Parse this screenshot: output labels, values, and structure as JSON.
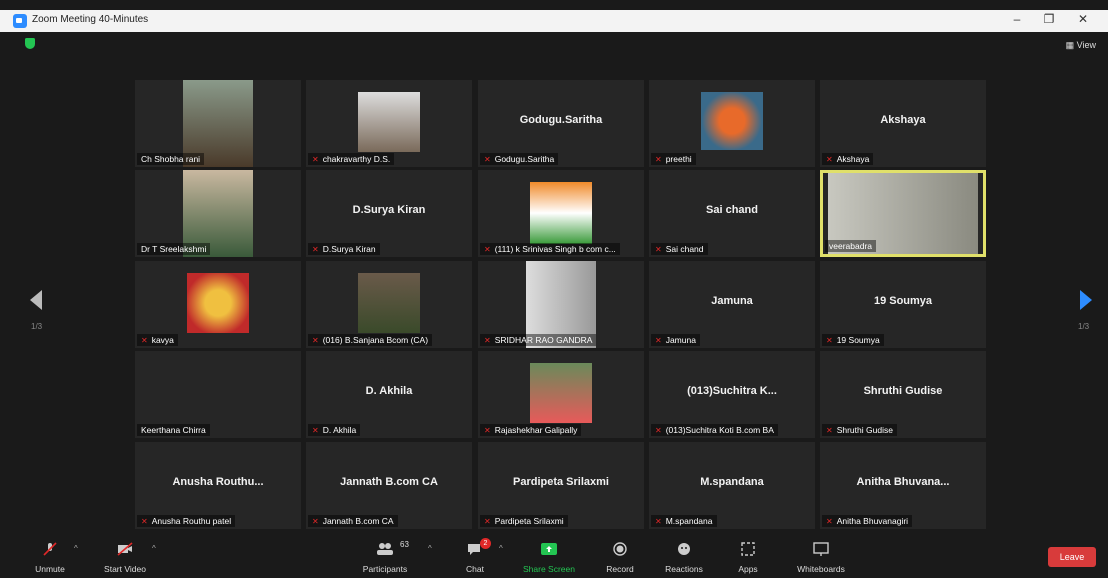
{
  "window": {
    "title": "Zoom Meeting 40-Minutes",
    "view_label": "View"
  },
  "paging": {
    "left": "1/3",
    "right": "1/3"
  },
  "tiles": [
    {
      "name": "Ch Shobha rani",
      "display": "",
      "muted": false
    },
    {
      "name": "chakravarthy D.S.",
      "display": "",
      "muted": true
    },
    {
      "name": "Godugu.Saritha",
      "display": "Godugu.Saritha",
      "muted": true
    },
    {
      "name": "preethi",
      "display": "",
      "muted": true
    },
    {
      "name": "Akshaya",
      "display": "Akshaya",
      "muted": true
    },
    {
      "name": "Dr T Sreelakshmi",
      "display": "",
      "muted": false
    },
    {
      "name": "D.Surya Kiran",
      "display": "D.Surya Kiran",
      "muted": true
    },
    {
      "name": "(111) k Srinivas Singh b com c...",
      "display": "",
      "muted": true
    },
    {
      "name": "Sai chand",
      "display": "Sai chand",
      "muted": true
    },
    {
      "name": "veerabadra",
      "display": "",
      "muted": false
    },
    {
      "name": "kavya",
      "display": "",
      "muted": true
    },
    {
      "name": "(016) B.Sanjana Bcom (CA)",
      "display": "",
      "muted": true
    },
    {
      "name": "SRIDHAR RAO GANDRA",
      "display": "",
      "muted": true
    },
    {
      "name": "Jamuna",
      "display": "Jamuna",
      "muted": true
    },
    {
      "name": "19 Soumya",
      "display": "19 Soumya",
      "muted": true
    },
    {
      "name": "Keerthana Chirra",
      "display": "",
      "muted": false
    },
    {
      "name": "D. Akhila",
      "display": "D. Akhila",
      "muted": true
    },
    {
      "name": "Rajashekhar Galipally",
      "display": "",
      "muted": true
    },
    {
      "name": "(013)Suchitra Koti B.com BA",
      "display": "(013)Suchitra K...",
      "muted": true
    },
    {
      "name": "Shruthi Gudise",
      "display": "Shruthi Gudise",
      "muted": true
    },
    {
      "name": "Anusha Routhu patel",
      "display": "Anusha Routhu...",
      "muted": true
    },
    {
      "name": "Jannath B.com CA",
      "display": "Jannath B.com CA",
      "muted": true
    },
    {
      "name": "Pardipeta Srilaxmi",
      "display": "Pardipeta Srilaxmi",
      "muted": true
    },
    {
      "name": "M.spandana",
      "display": "M.spandana",
      "muted": true
    },
    {
      "name": "Anitha Bhuvanagiri",
      "display": "Anitha Bhuvana...",
      "muted": true
    }
  ],
  "toolbar": {
    "unmute": "Unmute",
    "start_video": "Start Video",
    "participants": "Participants",
    "participants_count": "63",
    "chat": "Chat",
    "chat_badge": "2",
    "share_screen": "Share Screen",
    "record": "Record",
    "reactions": "Reactions",
    "apps": "Apps",
    "whiteboards": "Whiteboards",
    "leave": "Leave"
  },
  "colors": {
    "accent_green": "#23c552",
    "leave_red": "#d83b3b",
    "active_speaker": "#e0e06a",
    "tile_bg": "#262626"
  }
}
